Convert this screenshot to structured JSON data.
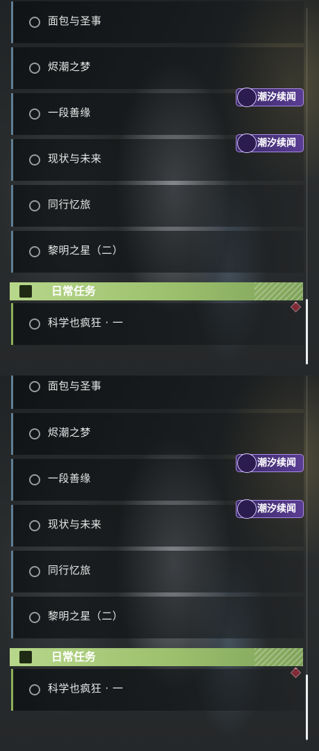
{
  "panels": [
    {
      "quests": [
        {
          "label": "面包与圣事"
        },
        {
          "label": "烬潮之梦"
        },
        {
          "label": "一段善缘"
        },
        {
          "label": "现状与未来"
        },
        {
          "label": "同行忆旅"
        },
        {
          "label": "黎明之星（二）"
        }
      ],
      "tags": [
        {
          "text": "潮汐续闻"
        },
        {
          "text": "潮汐续闻"
        }
      ],
      "category": {
        "title": "日常任务",
        "icon": "exclamation-icon"
      },
      "daily_quest": {
        "label": "科学也疯狂 · 一"
      }
    },
    {
      "quests": [
        {
          "label": "面包与圣事"
        },
        {
          "label": "烬潮之梦"
        },
        {
          "label": "一段善缘"
        },
        {
          "label": "现状与未来"
        },
        {
          "label": "同行忆旅"
        },
        {
          "label": "黎明之星（二）"
        }
      ],
      "tags": [
        {
          "text": "潮汐续闻"
        },
        {
          "text": "潮汐续闻"
        }
      ],
      "category": {
        "title": "日常任务",
        "icon": "exclamation-icon"
      },
      "daily_quest": {
        "label": "科学也疯狂 · 一"
      }
    }
  ],
  "colors": {
    "quest_bar": "#5f7f95",
    "daily_bar": "#8fb15a",
    "category_bg": "#b7d78a",
    "tag_bg": "#5a3d93",
    "marker": "#d8334a"
  }
}
